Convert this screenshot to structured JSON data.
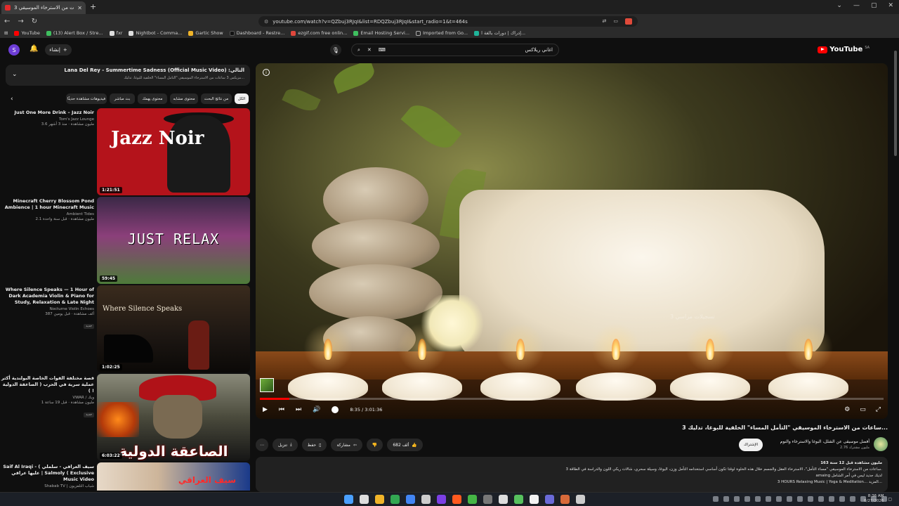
{
  "browser": {
    "tab_title": "3 ساعات من الاسترخاء الموسيقي",
    "url": "youtube.com/watch?v=QZbuj3RJqI&list=RDQZbuj3RJqI&start_radio=1&t=464s",
    "window_controls": [
      "⌄",
      "—",
      "▢",
      "✕"
    ],
    "bookmarks": [
      {
        "label": "YouTube",
        "color": "#ff0000"
      },
      {
        "label": "(13) Alert Box / Stre...",
        "color": "#3fbf5f"
      },
      {
        "label": "fxr",
        "color": "#dddddd"
      },
      {
        "label": "Nightbot - Comma...",
        "color": "#dddddd"
      },
      {
        "label": "Gartic Show",
        "color": "#f0b429"
      },
      {
        "label": "Dashboard - Restre...",
        "color": "#111111"
      },
      {
        "label": "ezgif.com free onlin...",
        "color": "#e0473c"
      },
      {
        "label": "Email Hosting Servi...",
        "color": "#3fbf5f"
      },
      {
        "label": "Imported from Go...",
        "color": "#444444"
      },
      {
        "label": "إدراك | دورات بالغة ا...",
        "color": "#1fb59a"
      }
    ]
  },
  "header": {
    "avatar_letter": "S",
    "create_label": "إنشاء",
    "search_query": "اغاني ريلاكس",
    "logo_text": "YouTube",
    "logo_region": "SA"
  },
  "playlist": {
    "now_playing": "Lana Del Rey - Summertime Sadness (Official Music Video) :التالي",
    "subtitle": "مزيكس 3 ساعات من الاسترخاء الموسيقي \"التأمل المساء\" الخلفية للبوغا، تدليك..."
  },
  "chips": [
    {
      "label": "الكل",
      "active": true
    },
    {
      "label": "من نتائج البحث",
      "active": false
    },
    {
      "label": "محتوى مشابه",
      "active": false
    },
    {
      "label": "محتوى يهمك",
      "active": false
    },
    {
      "label": "بث مباشر",
      "active": false
    },
    {
      "label": "فيديوهات مشاهدة حديثًا",
      "active": false
    }
  ],
  "recommendations": [
    {
      "title": "Just One More Drink – Jazz Noir",
      "channel": "Tom's Jazz Lounge",
      "meta": "3.6 مليون مشاهدة · منذ 3 أشهر",
      "duration": "1:21:51",
      "thumb_text": "Jazz Noir"
    },
    {
      "title": "Minecraft Cherry Blossom Pond Ambience | 1 hour Minecraft Music",
      "channel": "Ambient Tides",
      "meta": "2.1 مليون مشاهدة · قبل سنة واحدة",
      "duration": "59:45",
      "thumb_text": "JUST RELAX"
    },
    {
      "title": "Where Silence Speaks — 1 Hour of Dark Academia Violin & Piano for Study, Relaxation & Late Night",
      "channel": "Nocturne Violin Echoes",
      "meta": "387 ألف مشاهدة · قبل يومين",
      "badge": "جديد",
      "duration": "1:02:25",
      "thumb_text": "Where Silence Speaks"
    },
    {
      "title": "قصة مختلفة القوات الخاصة البولندية أكثر عملية سرية في الحرب ( الصاعقة الدولية ) !",
      "channel": "VWAR / ويك",
      "meta": "1 مليون مشاهدة · قبل 19 ساعة",
      "badge": "جديد",
      "duration": "6:03:22",
      "thumb_text": "الصاعقة الدولية"
    },
    {
      "title": "Saif Al Iraqi - ( سيف العراقي - سلملي عليها عراقي | Salmoly ( Exclusive Music Video",
      "channel": "Shabab TV | شباب التلفزيون",
      "meta": "",
      "duration": "",
      "thumb_text": "سيف العراقي"
    }
  ],
  "player": {
    "time_current": "8:35",
    "time_total": "3:01:36",
    "progress_fraction": 0.047,
    "watermark": "تسجيلات مراسي 3"
  },
  "video": {
    "title": "3 ساعات من الاسترخاء الموسيقي \"التأمل المساء\" الخلفية للبوغا، تدليك...",
    "channel_name": "أفضل موسيقى عن الشلل، البوغا والاسترخاء والنوم",
    "channel_subs": "2.76 مليون مشترك",
    "subscribe_label": "الإشتراك",
    "like_label": "682 ألف",
    "share_label": "مشاركة",
    "save_label": "حفظ",
    "download_label": "تنزيل",
    "views_line": "163 مليون مشاهدة قبل 12 سنة",
    "desc_line1": "3 ساعات من الاسترخاء الموسيقي \"مساء التأمل\"، الاسترخاء العقل والجسم خلال هذه الخلوة لوقتا تكون أساسي استخدامه التأمل وزن، اليوغا، وسيلة سحري، شالات ريكي اللون والدراسة في الطاقة.",
    "desc_line2": "amaing لديك جديد ليس في أمر الشامل",
    "desc_line3": "3 HOURS Relaxing Music | Yoga & Meditation... المزيد..."
  },
  "taskbar": {
    "time": "8:36 AM",
    "date": "6/27/2026",
    "apps": [
      "#4aa0ff",
      "#dddddd",
      "#f0b429",
      "#33a852",
      "#4285f4",
      "#cccccc",
      "#7b3fe4",
      "#ff5a1f",
      "#45b545",
      "#777777",
      "#dddddd",
      "#57c15e",
      "#f2f2f2",
      "#6a6ad8",
      "#d86a3a",
      "#cccccc"
    ]
  }
}
